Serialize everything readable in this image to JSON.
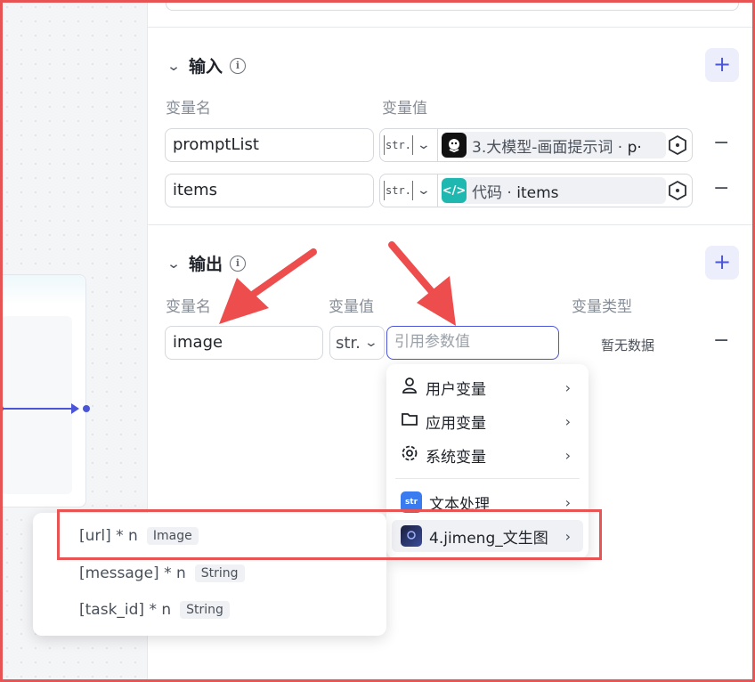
{
  "input_section": {
    "title": "输入",
    "col_name": "变量名",
    "col_value": "变量值",
    "add_label": "+",
    "rows": [
      {
        "name": "promptList",
        "type": "str.",
        "ref_prefix": "3.大模型-画面提示词 · ",
        "ref_var": "p·",
        "ref_icon_color": "#111111"
      },
      {
        "name": "items",
        "type": "str.",
        "ref_prefix": "代码 · ",
        "ref_var": "items",
        "ref_icon_color": "#1fb8b0"
      }
    ],
    "remove_label": "−"
  },
  "output_section": {
    "title": "输出",
    "col_name": "变量名",
    "col_value": "变量值",
    "col_type": "变量类型",
    "add_label": "+",
    "row": {
      "name": "image",
      "type": "str.",
      "ref_placeholder": "引用参数值",
      "var_type": "暂无数据"
    },
    "remove_label": "−"
  },
  "dropdown": {
    "items": [
      {
        "label": "用户变量",
        "icon": "user-icon"
      },
      {
        "label": "应用变量",
        "icon": "folder-icon"
      },
      {
        "label": "系统变量",
        "icon": "gear-icon"
      },
      {
        "label": "文本处理",
        "icon": "text-process-app-icon",
        "icon_text": "str"
      },
      {
        "label": "4.jimeng_文生图",
        "icon": "jimeng-app-icon"
      }
    ]
  },
  "submenu": {
    "items": [
      {
        "label": "[url] * n",
        "tag": "Image"
      },
      {
        "label": "[message] * n",
        "tag": "String"
      },
      {
        "label": "[task_id] * n",
        "tag": "String"
      }
    ]
  }
}
